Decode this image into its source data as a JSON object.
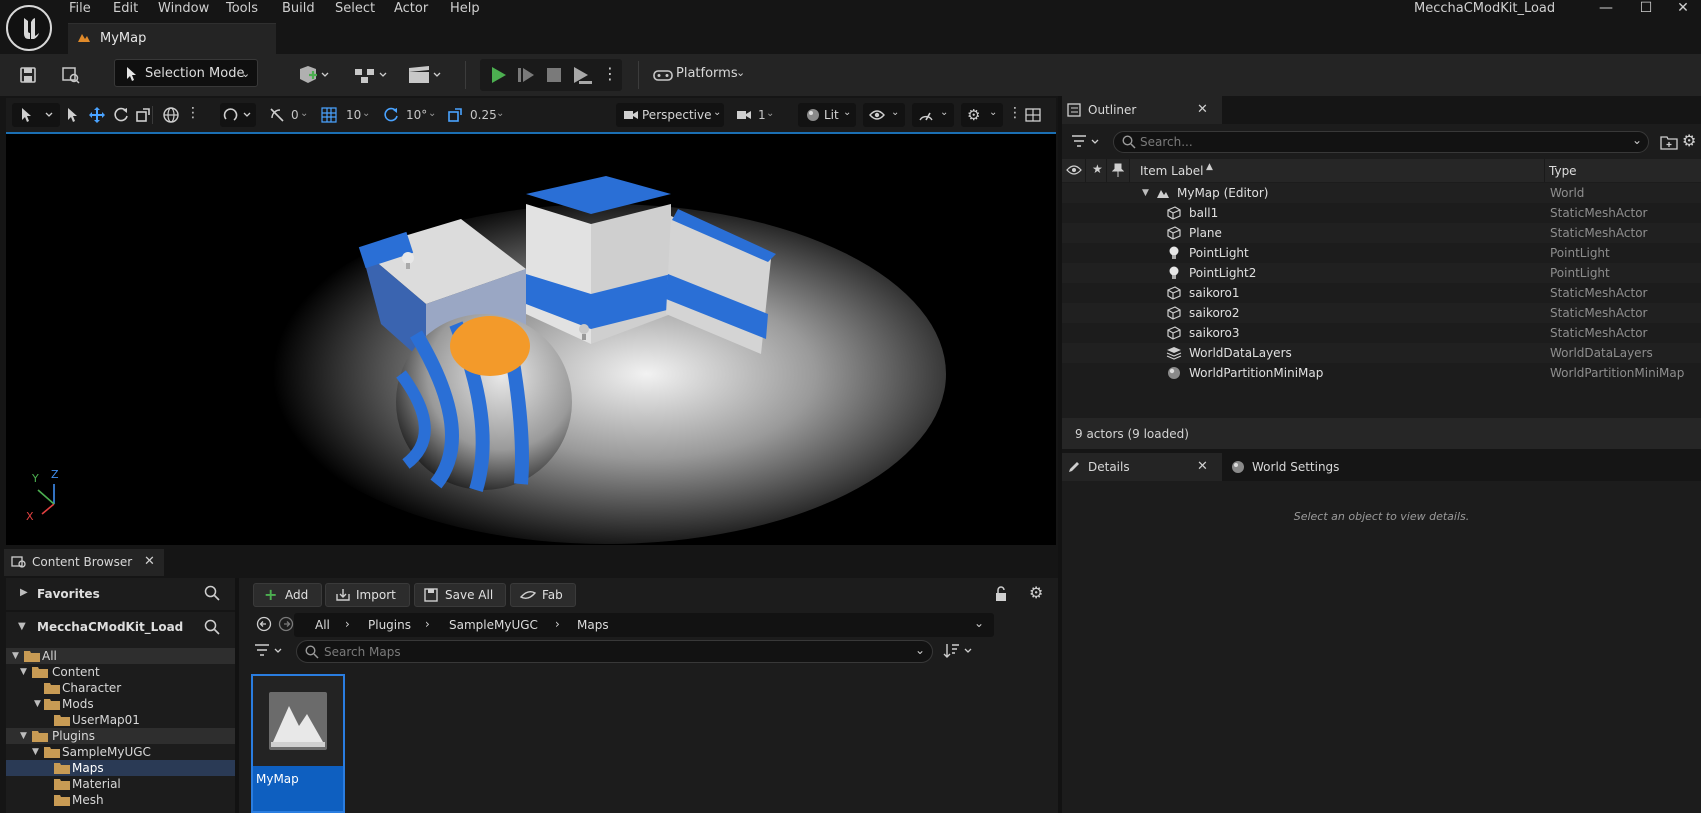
{
  "app": {
    "project_title": "MecchaCModKit_Load",
    "menu": [
      "File",
      "Edit",
      "Window",
      "Tools",
      "Build",
      "Select",
      "Actor",
      "Help"
    ],
    "document_tab": "MyMap",
    "window_controls": [
      "minimize-icon",
      "maximize-icon",
      "close-icon"
    ]
  },
  "toolbar": {
    "selection_mode": "Selection Mode",
    "platforms": "Platforms",
    "icons": [
      "save-icon",
      "browse-icon",
      "add-actor-icon",
      "blueprint-icon",
      "cinematics-icon",
      "play-icon",
      "advance-frame-icon",
      "stop-icon",
      "eject-icon",
      "more-options-icon",
      "platforms-icon"
    ],
    "play_color": "#4caf50"
  },
  "viewport": {
    "toolbar": {
      "rotation_snap_value": "0",
      "grid_value": "10",
      "angle_value": "10°",
      "scale_value": "0.25",
      "camera": "Perspective",
      "speed": "1",
      "view_mode": "Lit"
    },
    "axis_labels": {
      "x": "X",
      "y": "Y",
      "z": "Z"
    },
    "accent": "#1b6fb3"
  },
  "content_browser": {
    "tab_label": "Content Browser",
    "favorites_label": "Favorites",
    "project_label": "MecchaCModKit_Load",
    "buttons": {
      "add": "Add",
      "import": "Import",
      "save_all": "Save All",
      "fab": "Fab"
    },
    "breadcrumb": [
      "All",
      "Plugins",
      "SampleMyUGC",
      "Maps"
    ],
    "search_placeholder": "Search Maps",
    "tree": [
      {
        "label": "All",
        "level": 0,
        "expanded": true,
        "selected": "secondary"
      },
      {
        "label": "Content",
        "level": 1,
        "expanded": true
      },
      {
        "label": "Character",
        "level": 2
      },
      {
        "label": "Mods",
        "level": 2,
        "expanded": true
      },
      {
        "label": "UserMap01",
        "level": 3
      },
      {
        "label": "Plugins",
        "level": 1,
        "expanded": true,
        "selected": "secondary"
      },
      {
        "label": "SampleMyUGC",
        "level": 2,
        "expanded": true
      },
      {
        "label": "Maps",
        "level": 3,
        "selected": "primary"
      },
      {
        "label": "Material",
        "level": 3
      },
      {
        "label": "Mesh",
        "level": 3
      }
    ],
    "assets": [
      {
        "label": "MyMap",
        "icon": "map-icon"
      }
    ]
  },
  "outliner": {
    "tab_label": "Outliner",
    "search_placeholder": "Search...",
    "columns": {
      "label": "Item Label",
      "type": "Type"
    },
    "world": {
      "label": "MyMap (Editor)",
      "type": "World"
    },
    "rows": [
      {
        "label": "ball1",
        "type": "StaticMeshActor",
        "icon": "static-mesh-icon"
      },
      {
        "label": "Plane",
        "type": "StaticMeshActor",
        "icon": "static-mesh-icon"
      },
      {
        "label": "PointLight",
        "type": "PointLight",
        "icon": "light-bulb-icon"
      },
      {
        "label": "PointLight2",
        "type": "PointLight",
        "icon": "light-bulb-icon"
      },
      {
        "label": "saikoro1",
        "type": "StaticMeshActor",
        "icon": "static-mesh-icon"
      },
      {
        "label": "saikoro2",
        "type": "StaticMeshActor",
        "icon": "static-mesh-icon"
      },
      {
        "label": "saikoro3",
        "type": "StaticMeshActor",
        "icon": "static-mesh-icon"
      },
      {
        "label": "WorldDataLayers",
        "type": "WorldDataLayers",
        "icon": "layers-icon"
      },
      {
        "label": "WorldPartitionMiniMap",
        "type": "WorldPartitionMiniMap",
        "icon": "minimap-icon"
      }
    ],
    "status": "9 actors (9 loaded)"
  },
  "details": {
    "tab_label": "Details",
    "world_settings_label": "World Settings",
    "empty_message": "Select an object to view details."
  }
}
